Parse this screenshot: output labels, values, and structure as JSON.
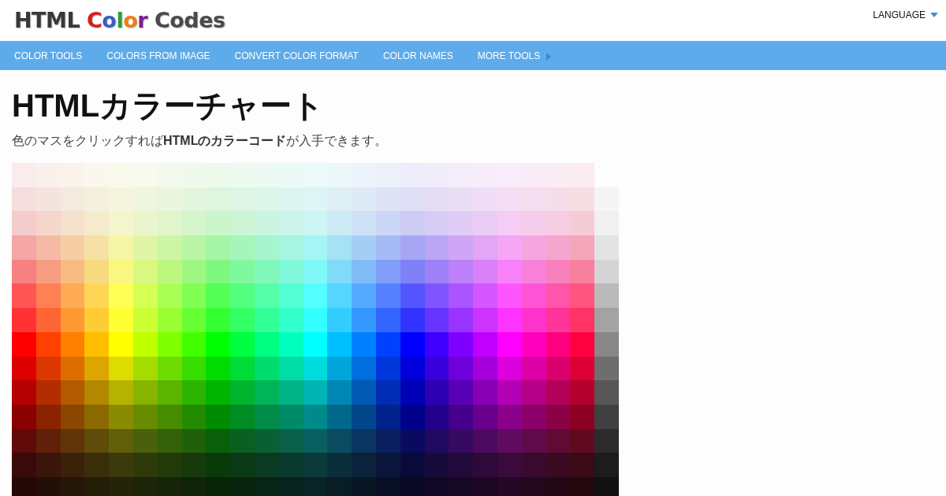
{
  "header": {
    "logo": {
      "parts": [
        {
          "text": "HTML ",
          "color": "#383838"
        },
        {
          "text": "C",
          "color": "#d81f1f"
        },
        {
          "text": "o",
          "color": "#3b5cc4"
        },
        {
          "text": "l",
          "color": "#2e9e3a"
        },
        {
          "text": "o",
          "color": "#f07d16"
        },
        {
          "text": "r ",
          "color": "#7a1f8f"
        },
        {
          "text": "Codes",
          "color": "#4a4a4a"
        }
      ]
    },
    "language": "LANGUAGE"
  },
  "nav": {
    "items": [
      {
        "label": "COLOR TOOLS",
        "has_arrow": false
      },
      {
        "label": "COLORS FROM IMAGE",
        "has_arrow": false
      },
      {
        "label": "CONVERT COLOR FORMAT",
        "has_arrow": false
      },
      {
        "label": "COLOR NAMES",
        "has_arrow": false
      },
      {
        "label": "MORE TOOLS",
        "has_arrow": true
      }
    ]
  },
  "title": "HTMLカラーチャート",
  "intro": "色のマスをクリックすれば**HTMLのカラーコード**が入手できます。",
  "color_chart": {
    "rows": [
      {
        "cells": [
          {
            "color": "#faecec"
          },
          {
            "color": "#faf0ec"
          },
          {
            "color": "#faf3ec"
          },
          {
            "color": "#faf7ec"
          },
          {
            "color": "#fafaec"
          },
          {
            "color": "#f7faec"
          },
          {
            "color": "#f3faec"
          },
          {
            "color": "#f0faec"
          },
          {
            "color": "#ecfaec"
          },
          {
            "color": "#ecfaf0"
          },
          {
            "color": "#ecfaf3"
          },
          {
            "color": "#ecfaf7"
          },
          {
            "color": "#ecfafa"
          },
          {
            "color": "#ecf7fa"
          },
          {
            "color": "#ecf3fa"
          },
          {
            "color": "#ecf0fa"
          },
          {
            "color": "#ececfa"
          },
          {
            "color": "#f0ecfa"
          },
          {
            "color": "#f3ecfa"
          },
          {
            "color": "#f7ecfa"
          },
          {
            "color": "#faecfa"
          },
          {
            "color": "#faecf7"
          },
          {
            "color": "#faecf3"
          },
          {
            "color": "#faecf0"
          }
        ]
      },
      {
        "cells": [
          {
            "color": "#f5dede"
          },
          {
            "color": "#f5e4de"
          },
          {
            "color": "#f5eade"
          },
          {
            "color": "#f5efde"
          },
          {
            "color": "#f5f5de"
          },
          {
            "color": "#eff5de"
          },
          {
            "color": "#eaf5de"
          },
          {
            "color": "#e4f5de"
          },
          {
            "color": "#def5de"
          },
          {
            "color": "#def5e4"
          },
          {
            "color": "#def5ea"
          },
          {
            "color": "#def5ef"
          },
          {
            "color": "#def5f5"
          },
          {
            "color": "#deeff5"
          },
          {
            "color": "#deeaf5"
          },
          {
            "color": "#dee4f5"
          },
          {
            "color": "#dedef5"
          },
          {
            "color": "#e4def5"
          },
          {
            "color": "#eadef5"
          },
          {
            "color": "#efdef5"
          },
          {
            "color": "#f5def5"
          },
          {
            "color": "#f5deef"
          },
          {
            "color": "#f5deea"
          },
          {
            "color": "#f5dee4"
          },
          {
            "color": "#f5f5f5"
          }
        ]
      },
      {
        "cells": [
          {
            "color": "#f5cccc"
          },
          {
            "color": "#f5d6cc"
          },
          {
            "color": "#f5e1cc"
          },
          {
            "color": "#f5ebcc"
          },
          {
            "color": "#f5f5cc"
          },
          {
            "color": "#ebf5cc"
          },
          {
            "color": "#e1f5cc"
          },
          {
            "color": "#d6f5cc"
          },
          {
            "color": "#ccf5cc"
          },
          {
            "color": "#ccf5d6"
          },
          {
            "color": "#ccf5e1"
          },
          {
            "color": "#ccf5eb"
          },
          {
            "color": "#ccf5f5"
          },
          {
            "color": "#ccebf5"
          },
          {
            "color": "#cce1f5"
          },
          {
            "color": "#ccd6f5"
          },
          {
            "color": "#ccccf5"
          },
          {
            "color": "#d6ccf5"
          },
          {
            "color": "#e1ccf5"
          },
          {
            "color": "#ebccf5"
          },
          {
            "color": "#f5ccf5"
          },
          {
            "color": "#f5cceb"
          },
          {
            "color": "#f5cce1"
          },
          {
            "color": "#f5ccd6"
          },
          {
            "color": "#f0f0f0"
          }
        ]
      },
      {
        "cells": [
          {
            "color": "#f5a6a6"
          },
          {
            "color": "#f5baa6"
          },
          {
            "color": "#f5cea6"
          },
          {
            "color": "#f5e1a6"
          },
          {
            "color": "#f5f5a6"
          },
          {
            "color": "#e1f5a6"
          },
          {
            "color": "#cef5a6"
          },
          {
            "color": "#baf5a6"
          },
          {
            "color": "#a6f5a6"
          },
          {
            "color": "#a6f5ba"
          },
          {
            "color": "#a6f5ce"
          },
          {
            "color": "#a6f5e1"
          },
          {
            "color": "#a6f5f5"
          },
          {
            "color": "#a6e1f5"
          },
          {
            "color": "#a6cef5"
          },
          {
            "color": "#a6baf5"
          },
          {
            "color": "#a6a6f5"
          },
          {
            "color": "#baa6f5"
          },
          {
            "color": "#cea6f5"
          },
          {
            "color": "#e1a6f5"
          },
          {
            "color": "#f5a6f5"
          },
          {
            "color": "#f5a6e1"
          },
          {
            "color": "#f5a6ce"
          },
          {
            "color": "#f5a6ba"
          },
          {
            "color": "#e3e3e3"
          }
        ]
      },
      {
        "cells": [
          {
            "color": "#f88080"
          },
          {
            "color": "#f89e80"
          },
          {
            "color": "#f8bc80"
          },
          {
            "color": "#f8da80"
          },
          {
            "color": "#f8f880"
          },
          {
            "color": "#daf880"
          },
          {
            "color": "#bcf880"
          },
          {
            "color": "#9ef880"
          },
          {
            "color": "#80f880"
          },
          {
            "color": "#80f89e"
          },
          {
            "color": "#80f8bc"
          },
          {
            "color": "#80f8da"
          },
          {
            "color": "#80f8f8"
          },
          {
            "color": "#80daf8"
          },
          {
            "color": "#80bcf8"
          },
          {
            "color": "#809ef8"
          },
          {
            "color": "#8080f8"
          },
          {
            "color": "#9e80f8"
          },
          {
            "color": "#bc80f8"
          },
          {
            "color": "#da80f8"
          },
          {
            "color": "#f880f8"
          },
          {
            "color": "#f880da"
          },
          {
            "color": "#f880bc"
          },
          {
            "color": "#f8809e"
          },
          {
            "color": "#d4d4d4"
          }
        ]
      },
      {
        "cells": [
          {
            "color": "#ff5555"
          },
          {
            "color": "#ff8055"
          },
          {
            "color": "#ffaa55"
          },
          {
            "color": "#ffd555"
          },
          {
            "color": "#ffff55"
          },
          {
            "color": "#d5ff55"
          },
          {
            "color": "#aaff55"
          },
          {
            "color": "#80ff55"
          },
          {
            "color": "#55ff55"
          },
          {
            "color": "#55ff80"
          },
          {
            "color": "#55ffaa"
          },
          {
            "color": "#55ffd5"
          },
          {
            "color": "#55ffff"
          },
          {
            "color": "#55d5ff"
          },
          {
            "color": "#55aaff"
          },
          {
            "color": "#5580ff"
          },
          {
            "color": "#5555ff"
          },
          {
            "color": "#8055ff"
          },
          {
            "color": "#aa55ff"
          },
          {
            "color": "#d555ff"
          },
          {
            "color": "#ff55ff"
          },
          {
            "color": "#ff55d5"
          },
          {
            "color": "#ff55aa"
          },
          {
            "color": "#ff5580"
          },
          {
            "color": "#bababa"
          }
        ]
      },
      {
        "cells": [
          {
            "color": "#ff3333"
          },
          {
            "color": "#ff6633"
          },
          {
            "color": "#ff9933"
          },
          {
            "color": "#ffcc33"
          },
          {
            "color": "#ffff33"
          },
          {
            "color": "#ccff33"
          },
          {
            "color": "#99ff33"
          },
          {
            "color": "#66ff33"
          },
          {
            "color": "#33ff33"
          },
          {
            "color": "#33ff66"
          },
          {
            "color": "#33ff99"
          },
          {
            "color": "#33ffcc"
          },
          {
            "color": "#33ffff"
          },
          {
            "color": "#33ccff"
          },
          {
            "color": "#3399ff"
          },
          {
            "color": "#3366ff"
          },
          {
            "color": "#3333ff"
          },
          {
            "color": "#6633ff"
          },
          {
            "color": "#9933ff"
          },
          {
            "color": "#cc33ff"
          },
          {
            "color": "#ff33ff"
          },
          {
            "color": "#ff33cc"
          },
          {
            "color": "#ff3399"
          },
          {
            "color": "#ff3366"
          },
          {
            "color": "#a3a3a3"
          }
        ]
      },
      {
        "cells": [
          {
            "color": "#ff0000"
          },
          {
            "color": "#ff4000"
          },
          {
            "color": "#ff8000"
          },
          {
            "color": "#ffbf00"
          },
          {
            "color": "#ffff00"
          },
          {
            "color": "#bfff00"
          },
          {
            "color": "#80ff00"
          },
          {
            "color": "#40ff00"
          },
          {
            "color": "#00ff00"
          },
          {
            "color": "#00ff40"
          },
          {
            "color": "#00ff80"
          },
          {
            "color": "#00ffbf"
          },
          {
            "color": "#00ffff"
          },
          {
            "color": "#00bfff"
          },
          {
            "color": "#0080ff"
          },
          {
            "color": "#0040ff"
          },
          {
            "color": "#0000ff"
          },
          {
            "color": "#4000ff"
          },
          {
            "color": "#8000ff"
          },
          {
            "color": "#bf00ff"
          },
          {
            "color": "#ff00ff"
          },
          {
            "color": "#ff00bf"
          },
          {
            "color": "#ff0080"
          },
          {
            "color": "#ff0040"
          },
          {
            "color": "#878787"
          }
        ]
      },
      {
        "cells": [
          {
            "color": "#dc0000"
          },
          {
            "color": "#dc3700"
          },
          {
            "color": "#dc6e00"
          },
          {
            "color": "#dca500"
          },
          {
            "color": "#dcdc00"
          },
          {
            "color": "#a5dc00"
          },
          {
            "color": "#6edc00"
          },
          {
            "color": "#37dc00"
          },
          {
            "color": "#00dc00"
          },
          {
            "color": "#00dc37"
          },
          {
            "color": "#00dc6e"
          },
          {
            "color": "#00dca5"
          },
          {
            "color": "#00dcdc"
          },
          {
            "color": "#00a5dc"
          },
          {
            "color": "#006edc"
          },
          {
            "color": "#0037dc"
          },
          {
            "color": "#0000dc"
          },
          {
            "color": "#3700dc"
          },
          {
            "color": "#6e00dc"
          },
          {
            "color": "#a500dc"
          },
          {
            "color": "#dc00dc"
          },
          {
            "color": "#dc00a5"
          },
          {
            "color": "#dc006e"
          },
          {
            "color": "#dc0037"
          },
          {
            "color": "#6e6e6e"
          }
        ]
      },
      {
        "cells": [
          {
            "color": "#b40000"
          },
          {
            "color": "#b42d00"
          },
          {
            "color": "#b45a00"
          },
          {
            "color": "#b48700"
          },
          {
            "color": "#b4b400"
          },
          {
            "color": "#87b400"
          },
          {
            "color": "#5ab400"
          },
          {
            "color": "#2db400"
          },
          {
            "color": "#00b400"
          },
          {
            "color": "#00b42d"
          },
          {
            "color": "#00b45a"
          },
          {
            "color": "#00b487"
          },
          {
            "color": "#00b4b4"
          },
          {
            "color": "#0087b4"
          },
          {
            "color": "#005ab4"
          },
          {
            "color": "#002db4"
          },
          {
            "color": "#0000b4"
          },
          {
            "color": "#2d00b4"
          },
          {
            "color": "#5a00b4"
          },
          {
            "color": "#8700b4"
          },
          {
            "color": "#b400b4"
          },
          {
            "color": "#b40087"
          },
          {
            "color": "#b4005a"
          },
          {
            "color": "#b4002d"
          },
          {
            "color": "#575757"
          }
        ]
      },
      {
        "cells": [
          {
            "color": "#8b0000"
          },
          {
            "color": "#8b2300"
          },
          {
            "color": "#8b4600"
          },
          {
            "color": "#8b6800"
          },
          {
            "color": "#8b8b00"
          },
          {
            "color": "#688b00"
          },
          {
            "color": "#468b00"
          },
          {
            "color": "#238b00"
          },
          {
            "color": "#008b00"
          },
          {
            "color": "#008b23"
          },
          {
            "color": "#008b46"
          },
          {
            "color": "#008b68"
          },
          {
            "color": "#008b8b"
          },
          {
            "color": "#00688b"
          },
          {
            "color": "#00468b"
          },
          {
            "color": "#00238b"
          },
          {
            "color": "#00008b"
          },
          {
            "color": "#23008b"
          },
          {
            "color": "#46008b"
          },
          {
            "color": "#68008b"
          },
          {
            "color": "#8b008b"
          },
          {
            "color": "#8b0068"
          },
          {
            "color": "#8b0046"
          },
          {
            "color": "#8b0023"
          },
          {
            "color": "#404040"
          }
        ]
      },
      {
        "cells": [
          {
            "color": "#600a0a"
          },
          {
            "color": "#60200a"
          },
          {
            "color": "#60350a"
          },
          {
            "color": "#604b0a"
          },
          {
            "color": "#60600a"
          },
          {
            "color": "#4b600a"
          },
          {
            "color": "#35600a"
          },
          {
            "color": "#20600a"
          },
          {
            "color": "#0a600a"
          },
          {
            "color": "#0a6020"
          },
          {
            "color": "#0a6035"
          },
          {
            "color": "#0a604b"
          },
          {
            "color": "#0a6060"
          },
          {
            "color": "#0a4b60"
          },
          {
            "color": "#0a3560"
          },
          {
            "color": "#0a2060"
          },
          {
            "color": "#0a0a60"
          },
          {
            "color": "#200a60"
          },
          {
            "color": "#350a60"
          },
          {
            "color": "#4b0a60"
          },
          {
            "color": "#600a60"
          },
          {
            "color": "#600a4b"
          },
          {
            "color": "#600a35"
          },
          {
            "color": "#600a20"
          },
          {
            "color": "#2b2b2b"
          }
        ]
      },
      {
        "cells": [
          {
            "color": "#3a0a0a"
          },
          {
            "color": "#3a160a"
          },
          {
            "color": "#3a220a"
          },
          {
            "color": "#3a2e0a"
          },
          {
            "color": "#3a3a0a"
          },
          {
            "color": "#2e3a0a"
          },
          {
            "color": "#223a0a"
          },
          {
            "color": "#163a0a"
          },
          {
            "color": "#0a3a0a"
          },
          {
            "color": "#0a3a16"
          },
          {
            "color": "#0a3a22"
          },
          {
            "color": "#0a3a2e"
          },
          {
            "color": "#0a3a3a"
          },
          {
            "color": "#0a2e3a"
          },
          {
            "color": "#0a223a"
          },
          {
            "color": "#0a163a"
          },
          {
            "color": "#0a0a3a"
          },
          {
            "color": "#160a3a"
          },
          {
            "color": "#220a3a"
          },
          {
            "color": "#2e0a3a"
          },
          {
            "color": "#3a0a3a"
          },
          {
            "color": "#3a0a2e"
          },
          {
            "color": "#3a0a22"
          },
          {
            "color": "#3a0a16"
          },
          {
            "color": "#1c1c1c"
          }
        ]
      },
      {
        "cells": [
          {
            "color": "#240808"
          },
          {
            "color": "#240f08"
          },
          {
            "color": "#241608"
          },
          {
            "color": "#241d08"
          },
          {
            "color": "#242408"
          },
          {
            "color": "#1d2408"
          },
          {
            "color": "#162408"
          },
          {
            "color": "#0f2408"
          },
          {
            "color": "#082408"
          },
          {
            "color": "#08240f"
          },
          {
            "color": "#082416"
          },
          {
            "color": "#08241d"
          },
          {
            "color": "#082424"
          },
          {
            "color": "#081d24"
          },
          {
            "color": "#081624"
          },
          {
            "color": "#080f24"
          },
          {
            "color": "#080824"
          },
          {
            "color": "#0f0824"
          },
          {
            "color": "#160824"
          },
          {
            "color": "#1d0824"
          },
          {
            "color": "#240824"
          },
          {
            "color": "#24081d"
          },
          {
            "color": "#240816"
          },
          {
            "color": "#24080f"
          },
          {
            "color": "#121212"
          }
        ]
      }
    ]
  }
}
